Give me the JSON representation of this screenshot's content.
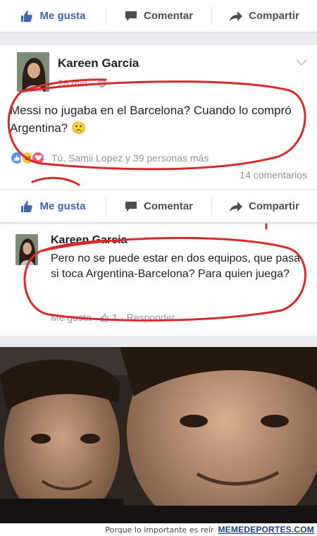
{
  "actions": {
    "like_label": "Me gusta",
    "comment_label": "Comentar",
    "share_label": "Compartir"
  },
  "post": {
    "author": "Kareen Garcia",
    "time": "28 min ·",
    "text": "Messi no jugaba en el Barcelona? Cuando lo compró Argentina? 🙁",
    "reactions_text": "Tú, Samii Lopez y 39 personas más",
    "comments_count": "14 comentarios"
  },
  "comment": {
    "author": "Kareen Garcia",
    "text": "Pero no se puede estar en dos equipos, que pasa si toca Argentina-Barcelona? Para quien juega?",
    "like_label": "Me gusta",
    "like_count": "1",
    "reply_label": "Responder"
  },
  "footer": {
    "caption": "Porque lo importante es reír",
    "brand": "MEMEDEPORTES.COM"
  },
  "colors": {
    "facebook_blue": "#4267b2",
    "annotation_red": "#d92a2a"
  }
}
